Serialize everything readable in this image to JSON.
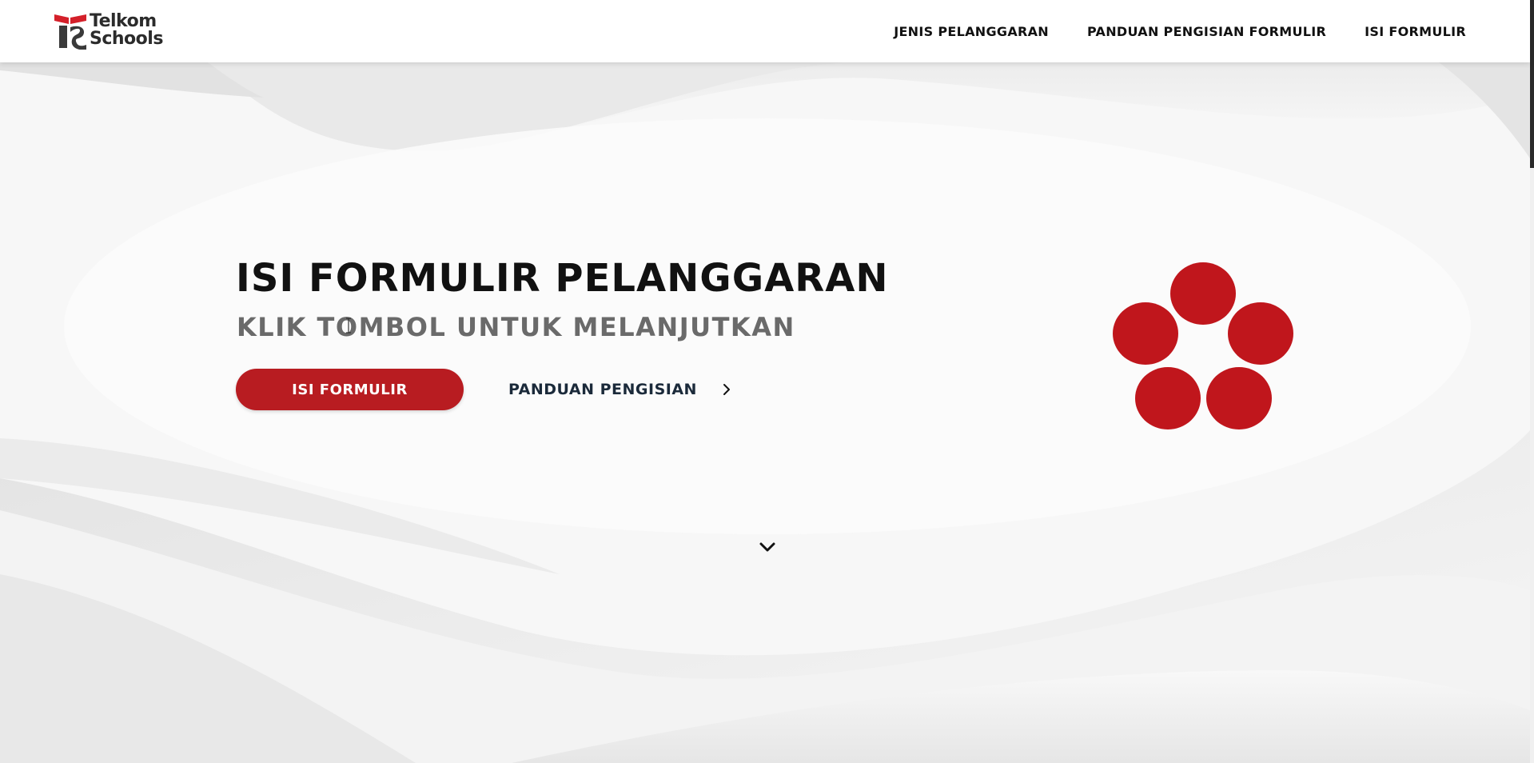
{
  "header": {
    "logo": {
      "line1": "Telkom",
      "line2": "Schools"
    },
    "nav": [
      {
        "label": "JENIS PELANGGARAN"
      },
      {
        "label": "PANDUAN PENGISIAN FORMULIR"
      },
      {
        "label": "ISI FORMULIR"
      }
    ]
  },
  "hero": {
    "title": "ISI FORMULIR PELANGGARAN",
    "subtitle": "KLIK TOMBOL UNTUK MELANJUTKAN",
    "primary_button": "ISI FORMULIR",
    "secondary_link": "PANDUAN PENGISIAN"
  },
  "colors": {
    "accent": "#b81c21",
    "loader_dots": "#c0161c",
    "text_dark": "#111111",
    "text_muted": "#6a6a6a"
  },
  "icons": {
    "secondary_link_icon": "chevron-right-icon",
    "scroll_icon": "chevron-down-icon",
    "loader": "spinner-dots-icon"
  }
}
